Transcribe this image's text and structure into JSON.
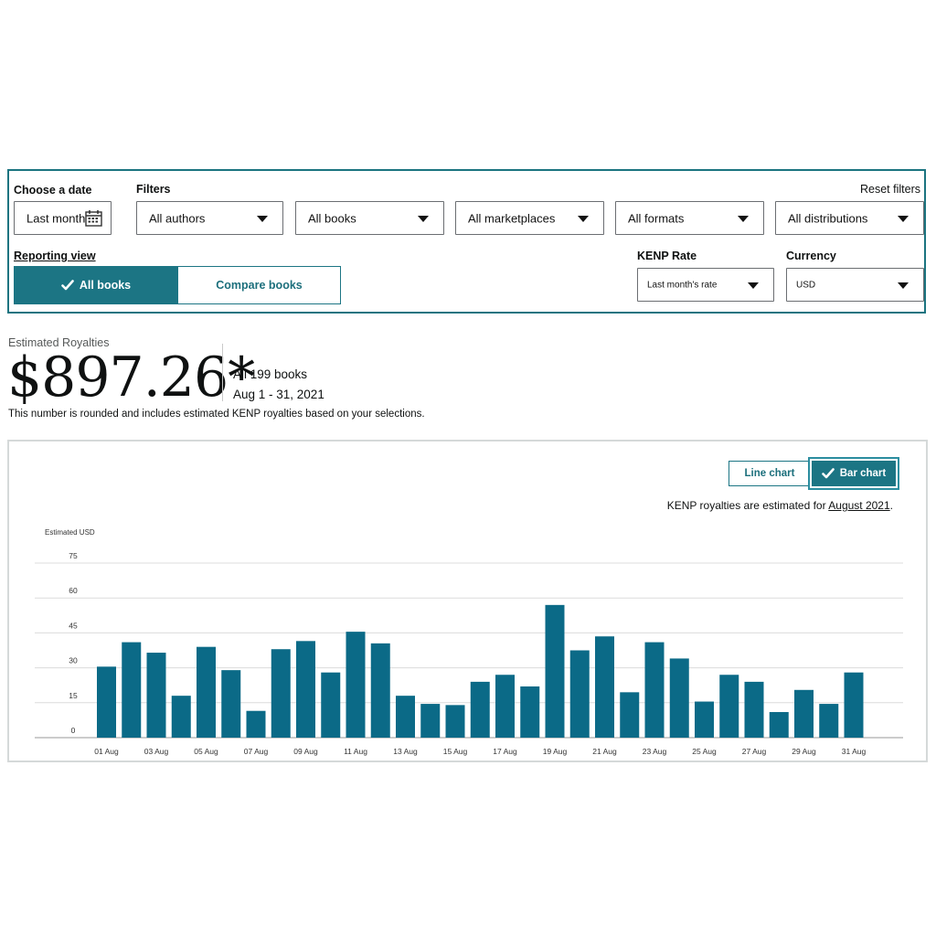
{
  "filters": {
    "date_label": "Choose a date",
    "date_value": "Last month",
    "filters_label": "Filters",
    "reset_label": "Reset filters",
    "authors": "All authors",
    "books": "All books",
    "marketplaces": "All marketplaces",
    "formats": "All formats",
    "distributions": "All distributions",
    "reporting_view_label": "Reporting view",
    "all_books_button": "All books",
    "compare_books_button": "Compare books",
    "kenp_rate_label": "KENP Rate",
    "kenp_rate_value": "Last month's rate",
    "currency_label": "Currency",
    "currency_value": "USD"
  },
  "summary": {
    "label": "Estimated Royalties",
    "amount": "$897.26*",
    "books": "All 199 books",
    "range": "Aug 1 - 31, 2021",
    "note": "This number is rounded and includes estimated KENP royalties based on your selections."
  },
  "chart_controls": {
    "line_chart": "Line chart",
    "bar_chart": "Bar chart",
    "kenp_note_prefix": "KENP royalties are estimated for ",
    "kenp_note_month": "August 2021",
    "kenp_note_suffix": "."
  },
  "colors": {
    "accent": "#1c7584",
    "bar": "#0b6a87",
    "border": "#1b7480"
  },
  "icons": {
    "calendar": "calendar-icon",
    "check": "check-icon",
    "dropdown": "chevron-down-icon"
  },
  "chart_data": {
    "type": "bar",
    "ylabel": "Estimated USD",
    "ylim": [
      0,
      75
    ],
    "yticks": [
      0,
      15,
      30,
      45,
      60,
      75
    ],
    "grid": true,
    "categories": [
      "01 Aug",
      "02 Aug",
      "03 Aug",
      "04 Aug",
      "05 Aug",
      "06 Aug",
      "07 Aug",
      "08 Aug",
      "09 Aug",
      "10 Aug",
      "11 Aug",
      "12 Aug",
      "13 Aug",
      "14 Aug",
      "15 Aug",
      "16 Aug",
      "17 Aug",
      "18 Aug",
      "19 Aug",
      "20 Aug",
      "21 Aug",
      "22 Aug",
      "23 Aug",
      "24 Aug",
      "25 Aug",
      "26 Aug",
      "27 Aug",
      "28 Aug",
      "29 Aug",
      "30 Aug",
      "31 Aug"
    ],
    "xtick_labels": [
      "01 Aug",
      "03 Aug",
      "05 Aug",
      "07 Aug",
      "09 Aug",
      "11 Aug",
      "13 Aug",
      "15 Aug",
      "17 Aug",
      "19 Aug",
      "21 Aug",
      "23 Aug",
      "25 Aug",
      "27 Aug",
      "29 Aug",
      "31 Aug"
    ],
    "values": [
      30.5,
      41,
      36.5,
      18,
      39,
      29,
      11.5,
      38,
      41.5,
      28,
      45.5,
      40.5,
      18,
      14.5,
      14,
      24,
      27,
      22,
      57,
      37.5,
      43.5,
      19.5,
      41,
      34,
      15.5,
      27,
      24,
      11,
      20.5,
      14.5,
      28
    ]
  }
}
